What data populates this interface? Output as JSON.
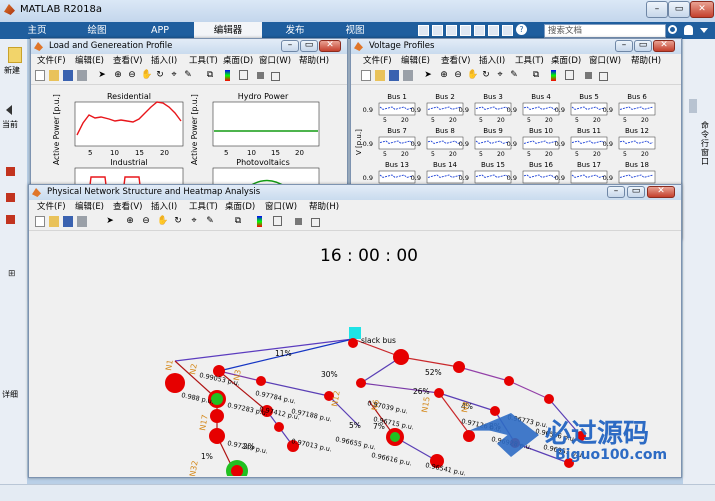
{
  "app_title": "MATLAB R2018a",
  "ribbon_tabs": [
    {
      "label": "主页"
    },
    {
      "label": "绘图"
    },
    {
      "label": "APP"
    },
    {
      "label": "编辑器"
    },
    {
      "label": "发布"
    },
    {
      "label": "视图"
    }
  ],
  "search_placeholder": "搜索文档",
  "new_label": "新建",
  "current_label": "当前",
  "detail_label": "详细",
  "command_label": "命令行窗口",
  "menu": [
    "文件(F)",
    "编辑(E)",
    "查看(V)",
    "插入(I)",
    "工具(T)",
    "桌面(D)",
    "窗口(W)",
    "帮助(H)"
  ],
  "fig1": {
    "title": "Load and Genereation Profile",
    "ylabel": "Active Power [p.u.]",
    "plots": [
      {
        "title": "Residential",
        "color": "#e8161b",
        "xticks": [
          "5",
          "10",
          "15",
          "20"
        ]
      },
      {
        "title": "Hydro Power",
        "color": "#129c12",
        "xticks": [
          "5",
          "10",
          "15",
          "20"
        ]
      },
      {
        "title": "Industrial",
        "color": "#e8161b"
      },
      {
        "title": "Photovoltaics",
        "color": "#129c12"
      }
    ]
  },
  "fig2": {
    "title": "Voltage Profiles",
    "ylabel": "V [p.u.]",
    "buses": [
      "Bus 1",
      "Bus 2",
      "Bus 3",
      "Bus 4",
      "Bus 5",
      "Bus 6",
      "Bus 7",
      "Bus 8",
      "Bus 9",
      "Bus 10",
      "Bus 11",
      "Bus 12",
      "Bus 13",
      "Bus 14",
      "Bus 15",
      "Bus 16",
      "Bus 17",
      "Bus 18"
    ],
    "ytick": "0.9",
    "xticks": [
      "5",
      "20"
    ]
  },
  "fig3": {
    "title": "Physical Network Structure and Heatmap Analysis",
    "clock": "16 : 00 : 00",
    "slack_label": "slack bus",
    "edge_labels": [
      "11%",
      "30%",
      "52%",
      "26%",
      "4%",
      "5%",
      "8%",
      "7%",
      "1%",
      "2%"
    ],
    "node_names": [
      "N1",
      "N2",
      "N3",
      "N6",
      "N8",
      "N12",
      "N15",
      "N17",
      "N32"
    ],
    "voltage_labels": [
      "0.99053 p.u.",
      "0.97784 p.u.",
      "0.97412 p.u.",
      "0.97283 p.u.",
      "0.97188 p.u.",
      "0.97039 p.u.",
      "0.96715 p.u.",
      "0.97126 p.u.",
      "0.96773 p.u.",
      "0.96556 p.u.",
      "0.96928 p.u.",
      "0.96951 p.u.",
      "0.97013 p.u.",
      "0.96655 p.u.",
      "0.96616 p.u.",
      "0.96541 p.u.",
      "0.96327 p.u.",
      "0.97372 p.u.",
      "0.97271 p.u.",
      "0.97249 p.u.",
      "0.988 p.u."
    ]
  },
  "watermark": {
    "title": "必过源码",
    "url": "Biguo100.com"
  }
}
